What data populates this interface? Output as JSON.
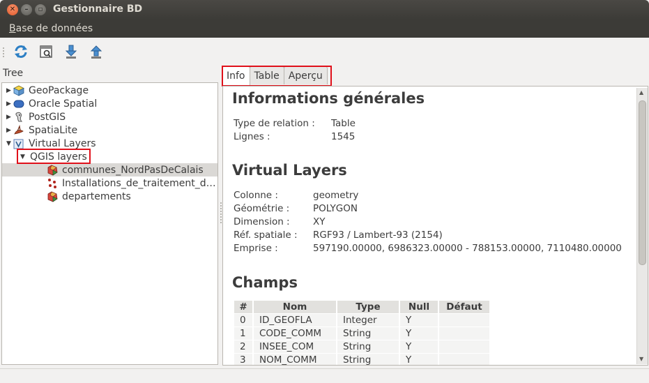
{
  "window": {
    "title": "Gestionnaire BD"
  },
  "menu": {
    "first_letter": "B",
    "rest": "ase de données"
  },
  "toolbar": {
    "buttons": [
      "refresh-icon",
      "sql-window-icon",
      "import-layer-icon",
      "export-icon"
    ]
  },
  "tree": {
    "label": "Tree",
    "nodes": [
      {
        "label": "GeoPackage",
        "icon": "geopackage-icon",
        "expanded": false
      },
      {
        "label": "Oracle Spatial",
        "icon": "oracle-icon",
        "expanded": false
      },
      {
        "label": "PostGIS",
        "icon": "postgis-icon",
        "expanded": false
      },
      {
        "label": "SpatiaLite",
        "icon": "spatialite-icon",
        "expanded": false
      },
      {
        "label": "Virtual Layers",
        "icon": "virtual-layers-icon",
        "expanded": true
      },
      {
        "label": "QGIS layers",
        "expanded": true
      },
      {
        "label": "communes_NordPasDeCalais",
        "icon": "polygon-layer-icon",
        "selected": true
      },
      {
        "label": "Installations_de_traitement_d…",
        "icon": "point-layer-icon"
      },
      {
        "label": "departements",
        "icon": "polygon-layer-icon"
      }
    ]
  },
  "tabs": [
    {
      "label": "Info",
      "active": true
    },
    {
      "label": "Table",
      "active": false
    },
    {
      "label": "Aperçu",
      "active": false
    }
  ],
  "info": {
    "general": {
      "heading": "Informations générales",
      "rows": [
        {
          "label": "Type de relation :",
          "value": "Table"
        },
        {
          "label": "Lignes :",
          "value": "1545"
        }
      ]
    },
    "virtual": {
      "heading": "Virtual Layers",
      "rows": [
        {
          "label": "Colonne :",
          "value": "geometry"
        },
        {
          "label": "Géométrie :",
          "value": "POLYGON"
        },
        {
          "label": "Dimension :",
          "value": "XY"
        },
        {
          "label": "Réf. spatiale :",
          "value": "RGF93 / Lambert-93 (2154)"
        },
        {
          "label": "Emprise :",
          "value": "597190.00000, 6986323.00000 - 788153.00000, 7110480.00000"
        }
      ]
    },
    "fields": {
      "heading": "Champs",
      "columns": [
        "#",
        "Nom",
        "Type",
        "Null",
        "Défaut"
      ],
      "rows": [
        [
          "0",
          "ID_GEOFLA",
          "Integer",
          "Y",
          ""
        ],
        [
          "1",
          "CODE_COMM",
          "String",
          "Y",
          ""
        ],
        [
          "2",
          "INSEE_COM",
          "String",
          "Y",
          ""
        ],
        [
          "3",
          "NOM_COMM",
          "String",
          "Y",
          ""
        ]
      ]
    }
  },
  "colors": {
    "highlight": "#e0101a",
    "titlebar": "#3c3b37",
    "close": "#e25a2b"
  }
}
